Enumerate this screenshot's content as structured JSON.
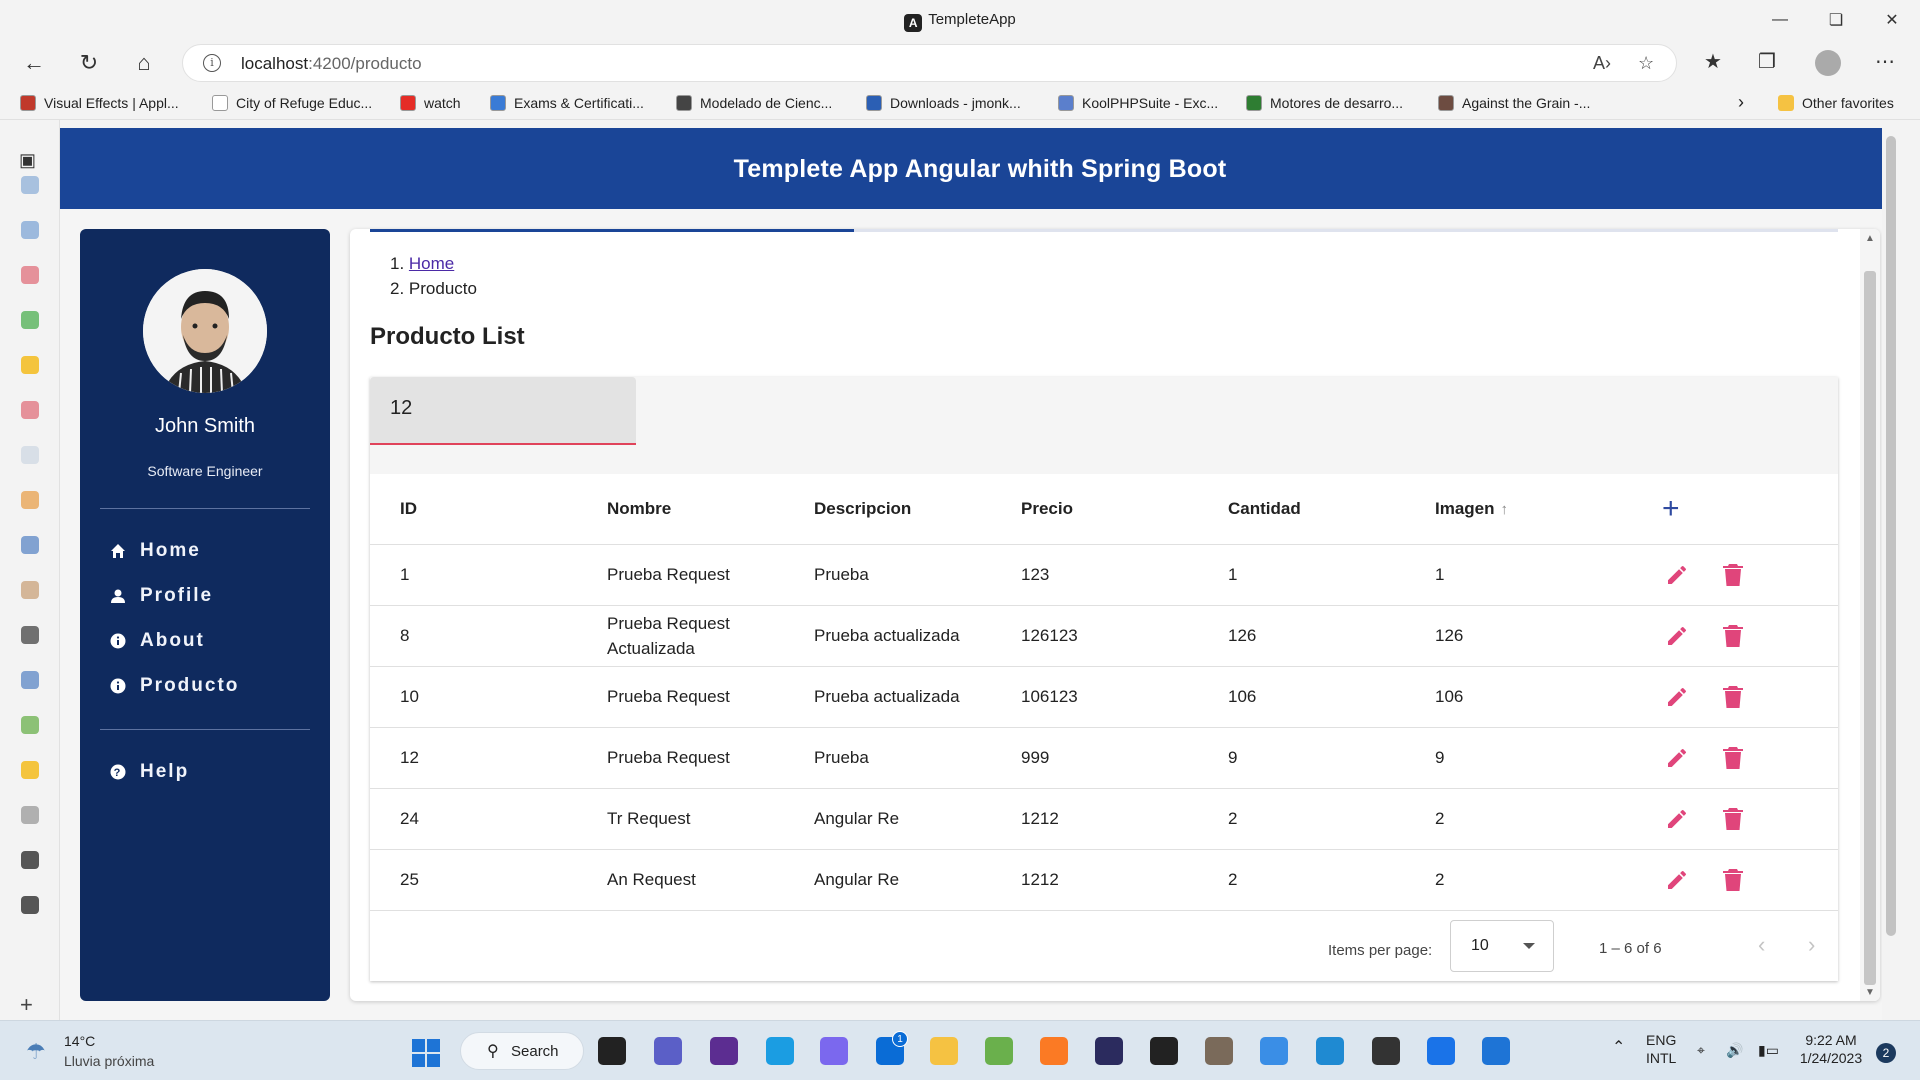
{
  "browser": {
    "window_title": "TempleteApp",
    "url_host": "localhost",
    "url_path": ":4200/producto",
    "favorites": [
      {
        "label": "Visual Effects | Appl...",
        "color": "#c0392b"
      },
      {
        "label": "City of Refuge Educ...",
        "color": "#ffffff"
      },
      {
        "label": "watch",
        "color": "#e52d27"
      },
      {
        "label": "Exams & Certificati...",
        "color": "#3a7bd5"
      },
      {
        "label": "Modelado de Cienc...",
        "color": "#444444"
      },
      {
        "label": "Downloads - jmonk...",
        "color": "#2b5fb4"
      },
      {
        "label": "KoolPHPSuite - Exc...",
        "color": "#5b7fcc"
      },
      {
        "label": "Motores de desarro...",
        "color": "#2e7d32"
      },
      {
        "label": "Against the Grain -...",
        "color": "#6d4c41"
      }
    ],
    "other_favorites": "Other favorites"
  },
  "app": {
    "header_title": "Templete App Angular whith Spring Boot",
    "profile": {
      "name": "John Smith",
      "role": "Software Engineer"
    },
    "nav": [
      {
        "label": "Home",
        "icon": "home-icon"
      },
      {
        "label": "Profile",
        "icon": "person-icon"
      },
      {
        "label": "About",
        "icon": "info-icon"
      },
      {
        "label": "Producto",
        "icon": "info-icon"
      }
    ],
    "help": {
      "label": "Help",
      "icon": "help-icon"
    },
    "progress_fraction": 0.33,
    "breadcrumb": [
      {
        "label": "Home",
        "link": true
      },
      {
        "label": "Producto",
        "link": false
      }
    ],
    "list_title": "Producto List",
    "filter_value": "12",
    "table": {
      "columns": [
        "ID",
        "Nombre",
        "Descripcion",
        "Precio",
        "Cantidad",
        "Imagen"
      ],
      "sorted_column": "Imagen",
      "rows": [
        {
          "id": "1",
          "nombre": "Prueba Request",
          "descripcion": "Prueba",
          "precio": "123",
          "cantidad": "1",
          "imagen": "1"
        },
        {
          "id": "8",
          "nombre": "Prueba Request Actualizada",
          "descripcion": "Prueba actualizada",
          "precio": "126123",
          "cantidad": "126",
          "imagen": "126"
        },
        {
          "id": "10",
          "nombre": "Prueba Request",
          "descripcion": "Prueba actualizada",
          "precio": "106123",
          "cantidad": "106",
          "imagen": "106"
        },
        {
          "id": "12",
          "nombre": "Prueba Request",
          "descripcion": "Prueba",
          "precio": "999",
          "cantidad": "9",
          "imagen": "9"
        },
        {
          "id": "24",
          "nombre": "Tr Request",
          "descripcion": "Angular Re",
          "precio": "1212",
          "cantidad": "2",
          "imagen": "2"
        },
        {
          "id": "25",
          "nombre": "An Request",
          "descripcion": "Angular Re",
          "precio": "1212",
          "cantidad": "2",
          "imagen": "2"
        }
      ]
    },
    "paginator": {
      "items_per_page_label": "Items per page:",
      "page_size": "10",
      "range": "1 – 6 of 6"
    }
  },
  "taskbar": {
    "temperature": "14°C",
    "weather": "Lluvia próxima",
    "search_label": "Search",
    "lang_top": "ENG",
    "lang_bottom": "INTL",
    "time": "9:22 AM",
    "date": "1/24/2023",
    "notifications": "2",
    "mail_badge": "1"
  },
  "colors": {
    "header": "#1a4597",
    "sidebar": "#0f2a5e",
    "action": "#e0457b",
    "accent": "#2f4aa0"
  }
}
